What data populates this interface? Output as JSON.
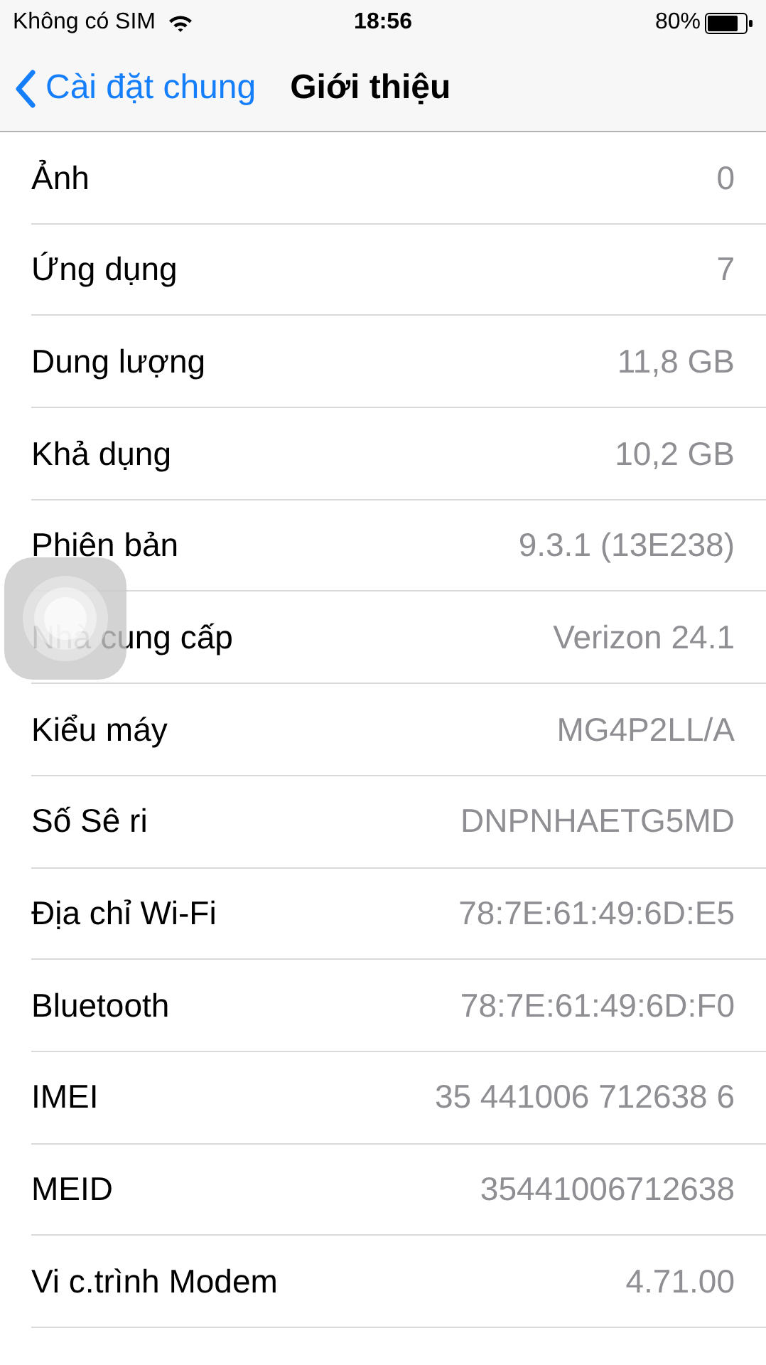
{
  "status_bar": {
    "carrier": "Không có SIM",
    "time": "18:56",
    "battery": "80%"
  },
  "nav": {
    "back": "Cài đặt chung",
    "title": "Giới thiệu"
  },
  "rows": [
    {
      "label": "Ảnh",
      "value": "0"
    },
    {
      "label": "Ứng dụng",
      "value": "7"
    },
    {
      "label": "Dung lượng",
      "value": "11,8 GB"
    },
    {
      "label": "Khả dụng",
      "value": "10,2 GB"
    },
    {
      "label": "Phiên bản",
      "value": "9.3.1 (13E238)"
    },
    {
      "label": "Nhà cung cấp",
      "value": "Verizon 24.1"
    },
    {
      "label": "Kiểu máy",
      "value": "MG4P2LL/A"
    },
    {
      "label": "Số Sê ri",
      "value": "DNPNHAETG5MD"
    },
    {
      "label": "Địa chỉ Wi-Fi",
      "value": "78:7E:61:49:6D:E5"
    },
    {
      "label": "Bluetooth",
      "value": "78:7E:61:49:6D:F0"
    },
    {
      "label": "IMEI",
      "value": "35 441006 712638 6"
    },
    {
      "label": "MEID",
      "value": "35441006712638"
    },
    {
      "label": "Vi c.trình Modem",
      "value": "4.71.00"
    }
  ]
}
